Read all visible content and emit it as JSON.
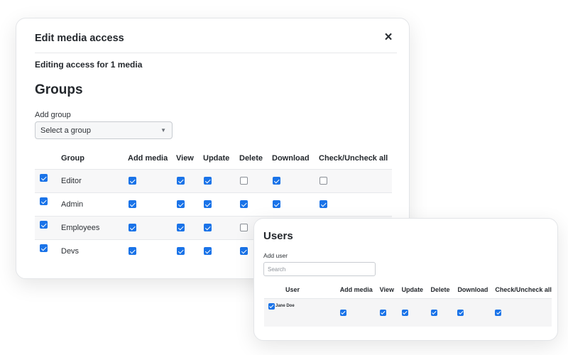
{
  "modal": {
    "title": "Edit media access",
    "close_icon": "×",
    "subtitle": "Editing access for 1 media",
    "groups_heading": "Groups",
    "add_group_label": "Add group",
    "select_value": "Select a group",
    "select_arrow": "▼",
    "columns": [
      "Group",
      "Add media",
      "View",
      "Update",
      "Delete",
      "Download",
      "Check/Uncheck all"
    ],
    "groups": [
      {
        "selected": true,
        "name": "Editor",
        "permissions": [
          true,
          true,
          true,
          false,
          true,
          false
        ]
      },
      {
        "selected": true,
        "name": "Admin",
        "permissions": [
          true,
          true,
          true,
          true,
          true,
          true
        ]
      },
      {
        "selected": true,
        "name": "Employees",
        "permissions": [
          true,
          true,
          true,
          false,
          false,
          false
        ]
      },
      {
        "selected": true,
        "name": "Devs",
        "permissions": [
          true,
          true,
          true,
          true,
          false,
          false
        ]
      }
    ]
  },
  "users": {
    "heading": "Users",
    "add_user_label": "Add user",
    "search_placeholder": "Search",
    "columns": [
      "User",
      "Add media",
      "View",
      "Update",
      "Delete",
      "Download",
      "Check/Uncheck all"
    ],
    "rows": [
      {
        "selected": true,
        "name": "Jane Doe",
        "permissions": [
          true,
          true,
          true,
          true,
          true,
          true
        ]
      }
    ]
  },
  "colors": {
    "accent": "#1a73e8"
  }
}
